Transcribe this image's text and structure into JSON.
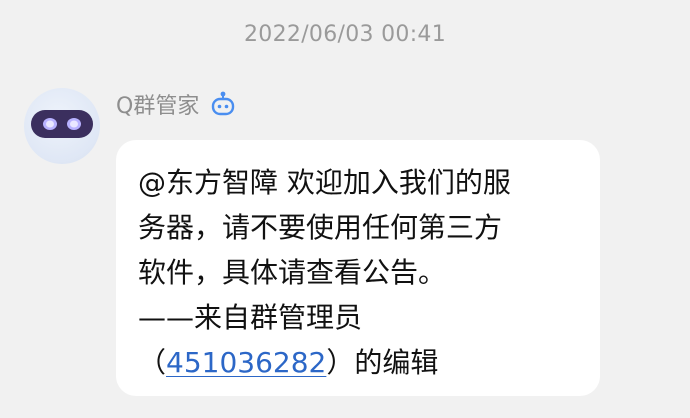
{
  "timestamp": "2022/06/03 00:41",
  "sender": {
    "name": "Q群管家",
    "badge_icon": "robot-icon"
  },
  "message": {
    "lines": [
      "@东方智障 欢迎加入我们的服",
      "务器，请不要使用任何第三方",
      "软件，具体请查看公告。",
      "——来自群管理员"
    ],
    "editor_prefix": "（",
    "editor_id": "451036282",
    "editor_suffix": "）的编辑"
  },
  "colors": {
    "background": "#f1f1f1",
    "bubble": "#ffffff",
    "link": "#2c67c7",
    "badge": "#4a8ef0"
  }
}
